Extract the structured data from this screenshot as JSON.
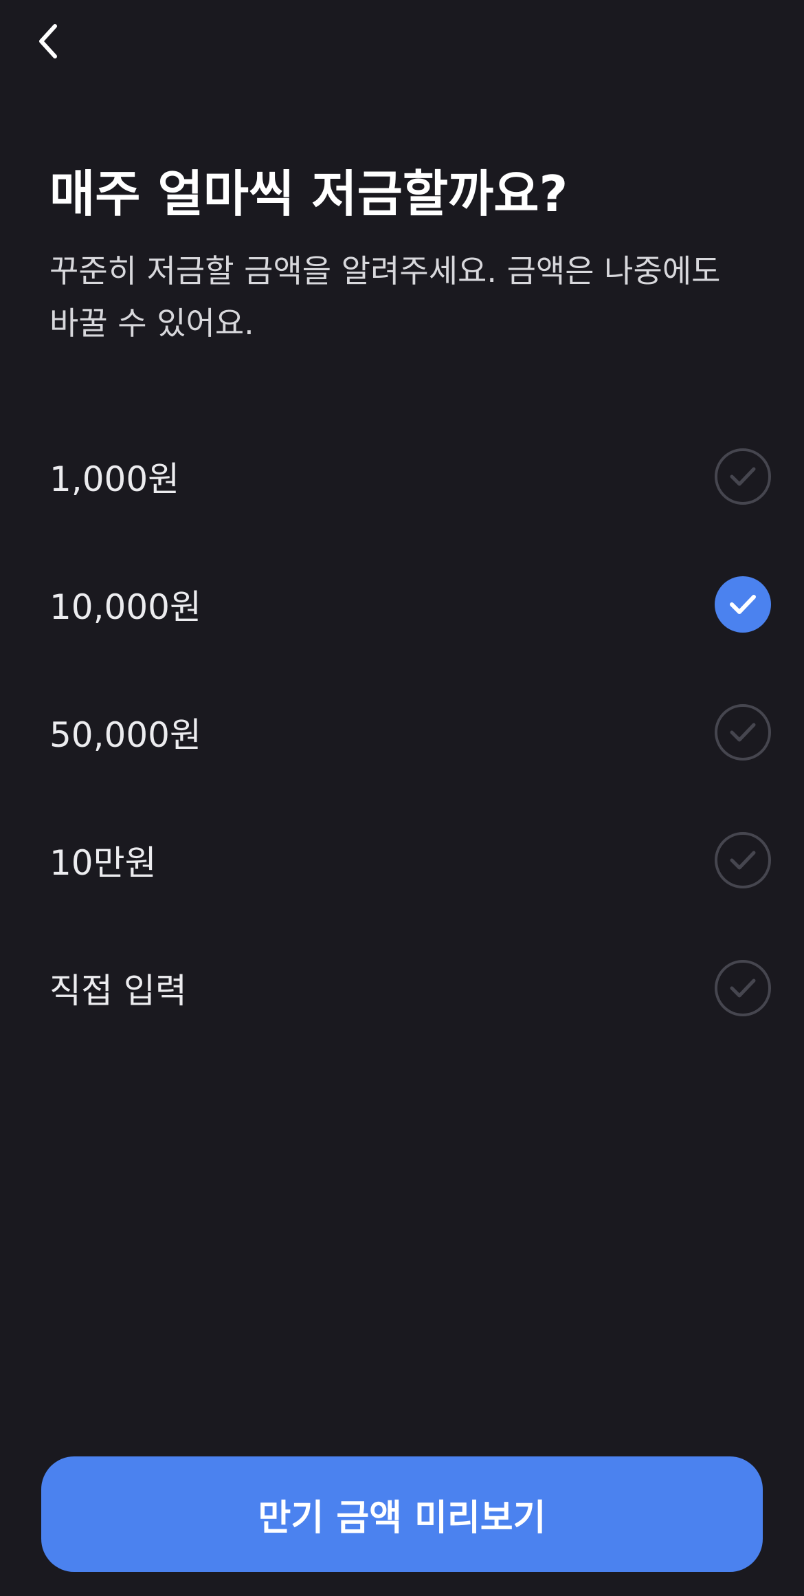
{
  "header": {
    "back_icon": "chevron-left-icon"
  },
  "title": "매주 얼마씩 저금할까요?",
  "subtitle_line1": "꾸준히 저금할 금액을 알려주세요. 금액은 나중에도",
  "subtitle_line2": "바꿀 수 있어요.",
  "options": [
    {
      "label": "1,000원",
      "selected": false
    },
    {
      "label": "10,000원",
      "selected": true
    },
    {
      "label": "50,000원",
      "selected": false
    },
    {
      "label": "10만원",
      "selected": false
    },
    {
      "label": "직접 입력",
      "selected": false
    }
  ],
  "cta": {
    "label": "만기 금액 미리보기"
  },
  "colors": {
    "background": "#1a191f",
    "accent": "#4b82ef",
    "check_off_border": "#46464f"
  }
}
